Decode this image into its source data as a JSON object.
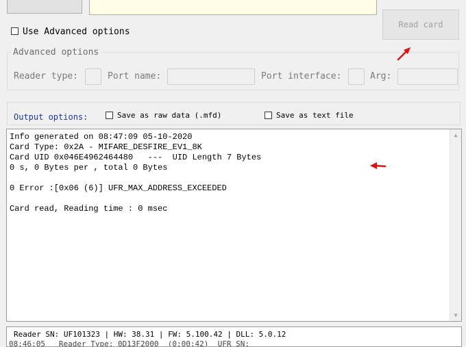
{
  "read_card": {
    "label": "Read card"
  },
  "use_advanced": {
    "label": "Use Advanced options",
    "checked": false
  },
  "advanced_options": {
    "legend": "Advanced options",
    "reader_type_label": "Reader type:",
    "port_name_label": "Port name:",
    "port_interface_label": "Port interface:",
    "arg_label": "Arg:"
  },
  "output_options": {
    "label": "Output options:",
    "raw_label": "Save as raw data (.mfd)",
    "text_label": "Save as text file"
  },
  "output": {
    "lines": "Info generated on 08:47:09 05-10-2020\nCard Type: 0x2A - MIFARE_DESFIRE_EV1_8K\nCard UID 0x046E4962464480   ---  UID Length 7 Bytes\n0 s, 0 Bytes per , total 0 Bytes\n\n0 Error :[0x06 (6)] UFR_MAX_ADDRESS_EXCEEDED\n\nCard read, Reading time : 0 msec"
  },
  "status": {
    "line1": "Reader SN: UF101323 | HW: 38.31 | FW: 5.100.42 | DLL: 5.0.12",
    "line2": "08:46:05   Reader Type: 0D13F2000  (0:00:42)  UFR SN:"
  },
  "colors": {
    "annotation": "#e01010",
    "output_label": "#1f3a93"
  }
}
